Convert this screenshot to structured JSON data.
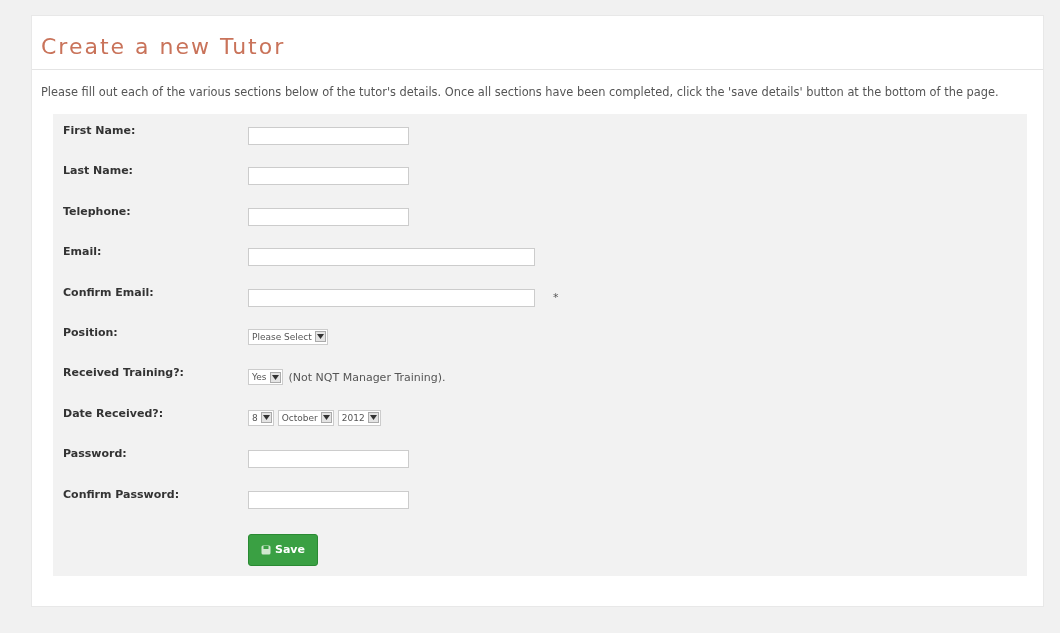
{
  "title": "Create a new Tutor",
  "intro": "Please fill out each of the various sections below of the tutor's details. Once all sections have been completed, click the 'save details' button at the bottom of the page.",
  "form": {
    "rows": [
      {
        "label": "First Name:",
        "controls": [
          {
            "kind": "input"
          }
        ]
      },
      {
        "label": "Last Name:",
        "controls": [
          {
            "kind": "input"
          }
        ]
      },
      {
        "label": "Telephone:",
        "controls": [
          {
            "kind": "input"
          }
        ]
      },
      {
        "label": "Email:",
        "controls": [
          {
            "kind": "wideinput"
          }
        ]
      },
      {
        "label": "Confirm Email:",
        "controls": [
          {
            "kind": "wideinput"
          },
          {
            "kind": "note",
            "text": "*"
          }
        ]
      },
      {
        "label": "Position:",
        "controls": [
          {
            "kind": "select",
            "value": "Please Select"
          }
        ]
      },
      {
        "label": "Received Training?:",
        "controls": [
          {
            "kind": "select",
            "value": "Yes"
          },
          {
            "kind": "note",
            "text": "(Not NQT Manager Training)."
          }
        ]
      },
      {
        "label": "Date Received?:",
        "controls": [
          {
            "kind": "select",
            "value": "8"
          },
          {
            "kind": "select",
            "value": "October"
          },
          {
            "kind": "select",
            "value": "2012"
          }
        ]
      },
      {
        "label": "Password:",
        "controls": [
          {
            "kind": "input"
          }
        ]
      },
      {
        "label": "Confirm Password:",
        "controls": [
          {
            "kind": "input"
          }
        ]
      }
    ],
    "submit": {
      "label": "Save"
    }
  }
}
